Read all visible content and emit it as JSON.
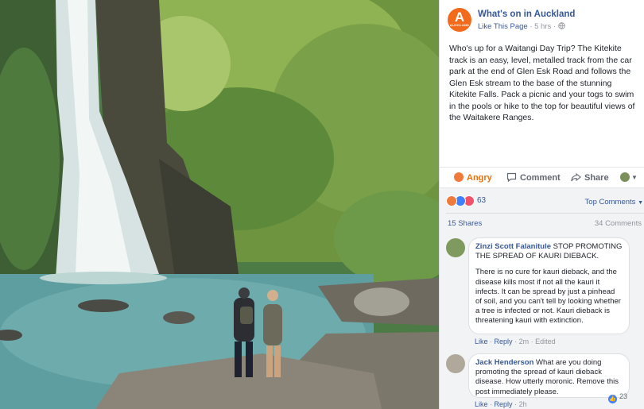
{
  "page": {
    "logo_letter": "A",
    "logo_subtext": "AUCKLAND",
    "name": "What's on in Auckland",
    "like_label": "Like This Page",
    "separator": "·",
    "time": "5 hrs",
    "privacy_icon": "globe-icon"
  },
  "post": {
    "text": "Who's up for a Waitangi Day Trip? The Kitekite track is an easy, level, metalled track from the car park at the end of Glen Esk Road and follows the Glen Esk stream to the base of the stunning Kitekite Falls. Pack a picnic and your togs to swim in the pools or hike to the top for beautiful views of the Waitakere Ranges."
  },
  "actions": {
    "angry": "Angry",
    "comment": "Comment",
    "share": "Share"
  },
  "summary": {
    "reaction_count": "63",
    "top_comments": "Top Comments",
    "shares": "15 Shares",
    "comments": "34 Comments"
  },
  "comments": [
    {
      "author": "Zinzi Scott Falanitule",
      "text_lead": "STOP PROMOTING THE SPREAD OF KAURI DIEBACK.",
      "text_body": "There is no cure for kauri dieback, and the disease kills most if not all the kauri it infects. It can be spread by just a pinhead of soil, and you can't tell by looking whether a tree is infected or not. Kauri dieback is threatening kauri with extinction.",
      "like": "Like",
      "reply": "Reply",
      "time": "2m",
      "edited": "Edited",
      "dot": "·"
    },
    {
      "author": "Jack Henderson",
      "text": "What are you doing promoting the spread of kauri dieback disease. How utterly moronic. Remove this post immediately please.",
      "like": "Like",
      "reply": "Reply",
      "time": "2h",
      "like_count": "23",
      "dot": "·"
    }
  ],
  "colors": {
    "link": "#365899",
    "angry": "#e9710f",
    "brand": "#f26a1b",
    "muted": "#90949c"
  }
}
